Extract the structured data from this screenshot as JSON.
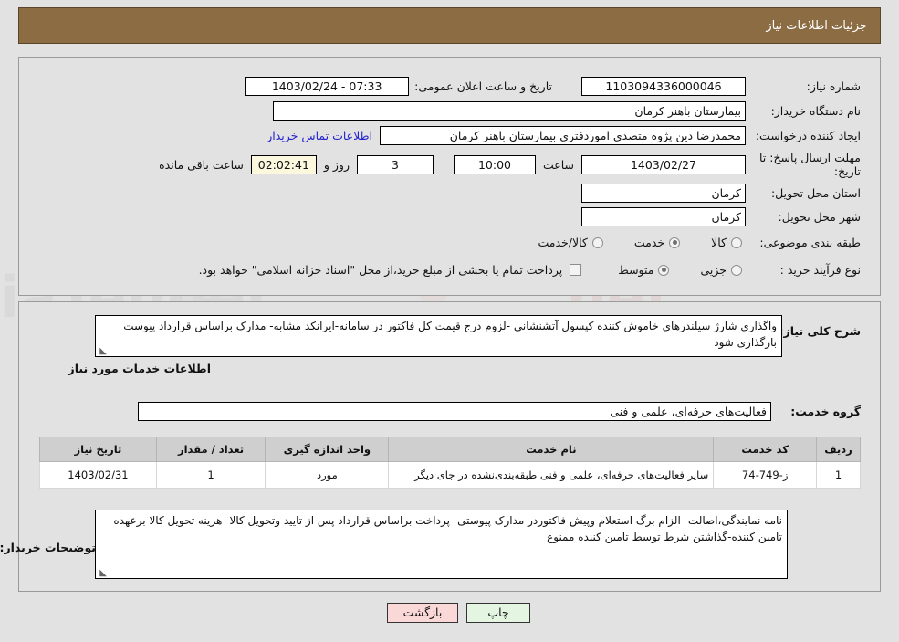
{
  "header": {
    "title": "جزئیات اطلاعات نیاز"
  },
  "top_form": {
    "need_number_label": "شماره نیاز:",
    "need_number_value": "1103094336000046",
    "announce_label": "تاریخ و ساعت اعلان عمومی:",
    "announce_value": "07:33 - 1403/02/24",
    "buyer_org_label": "نام دستگاه خریدار:",
    "buyer_org_value": "بیمارستان باهنر کرمان",
    "creator_label": "ایجاد کننده درخواست:",
    "creator_value": "محمدرضا  دین پژوه متصدی اموردفتری بیمارستان باهنر کرمان",
    "contact_link": "اطلاعات تماس خریدار",
    "deadline_label": "مهلت ارسال پاسخ: تا تاریخ:",
    "deadline_date": "1403/02/27",
    "hour_label": "ساعت",
    "hour_value": "10:00",
    "days_value": "3",
    "days_label": "روز و",
    "remaining_value": "02:02:41",
    "remaining_label": "ساعت باقی مانده",
    "province_label": "استان محل تحویل:",
    "province_value": "کرمان",
    "city_label": "شهر محل تحویل:",
    "city_value": "کرمان",
    "category_label": "طبقه بندی موضوعی:",
    "category_options": [
      {
        "label": "کالا",
        "selected": false
      },
      {
        "label": "خدمت",
        "selected": true
      },
      {
        "label": "کالا/خدمت",
        "selected": false
      }
    ],
    "process_label": "نوع فرآیند خرید :",
    "process_options": [
      {
        "label": "جزیی",
        "selected": false
      },
      {
        "label": "متوسط",
        "selected": true
      }
    ],
    "treasury_checkbox_checked": false,
    "treasury_text": "پرداخت تمام یا بخشی از مبلغ خرید،از محل \"اسناد خزانه اسلامی\" خواهد بود."
  },
  "bottom": {
    "general_desc_label": "شرح کلی نیاز:",
    "general_desc_value": "واگذاری شارژ سیلندرهای خاموش کننده کپسول آتشنشانی -لزوم درج قیمت کل فاکتور در سامانه-ایرانکد مشابه- مدارک براساس قرارداد پیوست بارگذاری شود",
    "services_info_title": "اطلاعات خدمات مورد نیاز",
    "service_group_label": "گروه خدمت:",
    "service_group_value": "فعالیت‌های حرفه‌ای، علمی و فنی",
    "table": {
      "columns": [
        "ردیف",
        "کد خدمت",
        "نام خدمت",
        "واحد اندازه گیری",
        "تعداد / مقدار",
        "تاریخ نیاز"
      ],
      "rows": [
        {
          "row": "1",
          "code": "ز-749-74",
          "name": "سایر فعالیت‌های حرفه‌ای، علمی و فنی طبقه‌بندی‌نشده در جای دیگر",
          "unit": "مورد",
          "qty": "1",
          "date": "1403/02/31"
        }
      ]
    },
    "buyer_notes_label": "توضیحات خریدار:",
    "buyer_notes_value": "نامه نمایندگی،اصالت -الزام برگ استعلام وپیش فاکتوردر مدارک پیوستی- پرداخت  براساس قرارداد پس از تایید وتحویل کالا- هزینه تحویل کالا برعهده تامین کننده-گذاشتن شرط توسط تامین کننده ممنوع"
  },
  "footer": {
    "print_label": "چاپ",
    "back_label": "بازگشت"
  },
  "colors": {
    "header_brown": "#8c6c43",
    "page_bg": "#e2e2e2",
    "link_blue": "#2222cc",
    "print_green": "#e4f5e2",
    "back_pink": "#fad8d8",
    "timer_yellow": "#fbf8dd"
  },
  "watermark": {
    "text": "AriaTender.net"
  }
}
